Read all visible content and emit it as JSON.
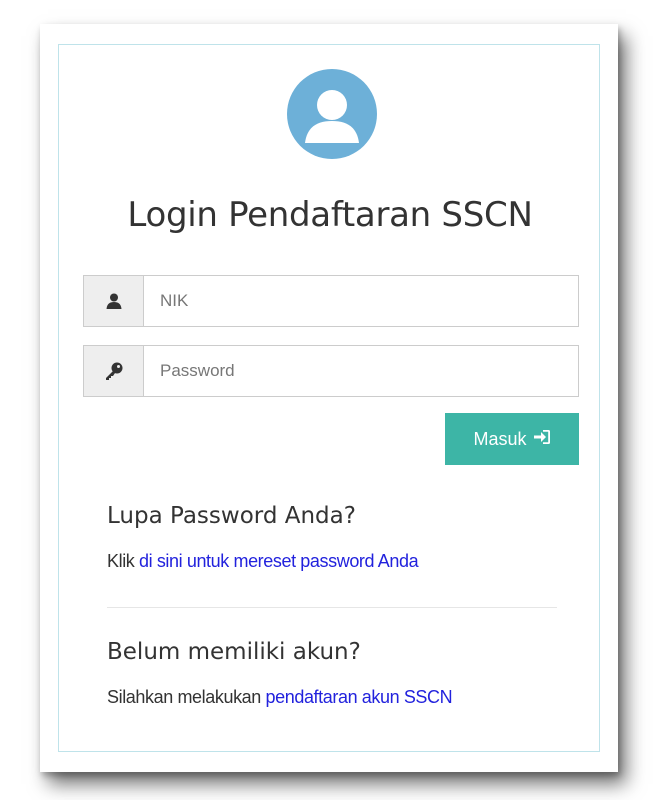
{
  "login": {
    "title": "Login Pendaftaran SSCN",
    "nik_placeholder": "NIK",
    "password_placeholder": "Password",
    "submit_label": "Masuk"
  },
  "forgot": {
    "heading": "Lupa Password Anda?",
    "prefix": "Klik ",
    "link_text": "di sini untuk mereset password Anda"
  },
  "register": {
    "heading": "Belum memiliki akun?",
    "prefix": "Silahkan melakukan ",
    "link_text": "pendaftaran akun SSCN"
  },
  "icons": {
    "avatar": "user-circle-icon",
    "nik": "user-icon",
    "password": "key-icon",
    "submit": "sign-in-icon"
  },
  "colors": {
    "avatar": "#6db0d8",
    "submit_button": "#3db5a6",
    "link": "#2222dd",
    "panel_border": "#bfe3ea"
  }
}
